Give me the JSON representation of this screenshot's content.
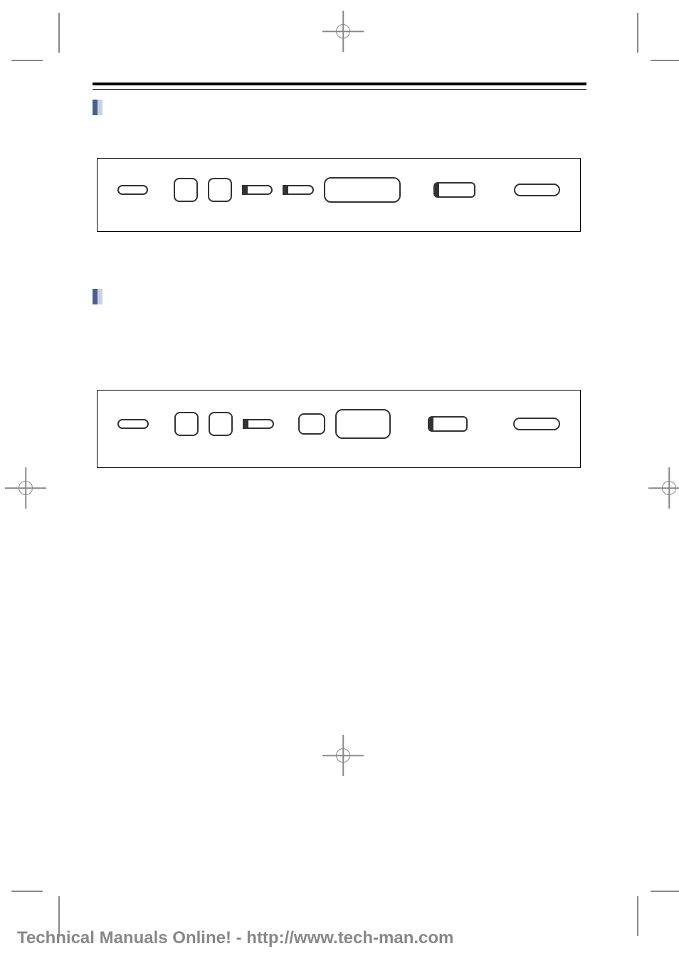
{
  "footer": {
    "text": "Technical Manuals Online! - http://www.tech-man.com"
  }
}
